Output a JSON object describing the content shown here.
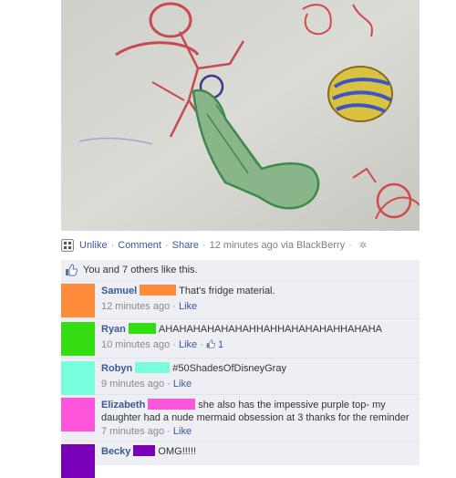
{
  "post": {
    "actions": {
      "unlike": "Unlike",
      "comment": "Comment",
      "share": "Share",
      "time": "12 minutes ago via BlackBerry"
    },
    "likes_text": "You and 7 others like this."
  },
  "comments": [
    {
      "author": "Samuel",
      "text": "That's fridge material.",
      "time": "12 minutes ago",
      "like": "Like",
      "color": "#ff8c3a"
    },
    {
      "author": "Ryan",
      "text": "AHAHAHAHAHAHAHHAHHAHAHAHAHHAHAHA",
      "time": "10 minutes ago",
      "like": "Like",
      "likes_count": "1",
      "color": "#33dd11"
    },
    {
      "author": "Robyn",
      "text": "#50ShadesOfDisneyGray",
      "time": "9 minutes ago",
      "like": "Like",
      "color": "#77ffdd"
    },
    {
      "author": "Elizabeth",
      "text": "she also has the impessive purple top- my daughter had a nude mermaid obsession at 3 thanks for the reminder",
      "time": "7 minutes ago",
      "like": "Like",
      "color": "#ff55dd"
    },
    {
      "author": "Becky",
      "text": "OMG!!!!!",
      "color": "#7a00b8"
    }
  ],
  "icons": {
    "app": "blackberry-app-icon",
    "gear": "gear-icon",
    "thumb": "thumbs-up-icon"
  }
}
